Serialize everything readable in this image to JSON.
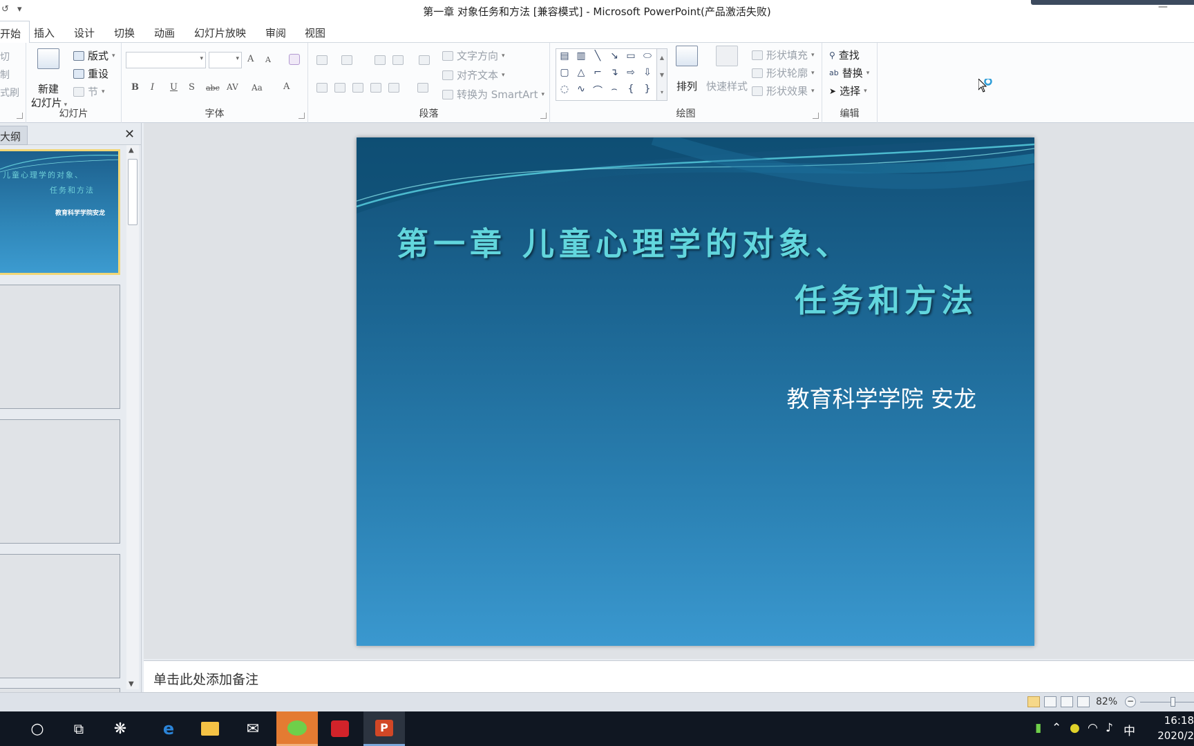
{
  "window": {
    "title": "第一章 对象任务和方法 [兼容模式] - Microsoft PowerPoint(产品激活失败)",
    "qat_undo": "↺",
    "qat_more": "▾",
    "minimize": "—"
  },
  "ribbon_tabs": [
    "开始",
    "插入",
    "设计",
    "切换",
    "动画",
    "幻灯片放映",
    "审阅",
    "视图"
  ],
  "clipboard": {
    "cut": "切",
    "copy": "制",
    "format_painter": "式刷"
  },
  "slides_group": {
    "label": "幻灯片",
    "new_slide_line1": "新建",
    "new_slide_line2": "幻灯片",
    "layout": "版式",
    "reset": "重设",
    "section": "节"
  },
  "font_group": {
    "label": "字体",
    "grow": "A",
    "shrink": "A",
    "bold": "B",
    "italic": "I",
    "underline": "U",
    "strike": "S",
    "abc": "abc",
    "spacing": "AV",
    "case": "Aa",
    "color": "A"
  },
  "paragraph_group": {
    "label": "段落",
    "text_direction": "文字方向",
    "align_text": "对齐文本",
    "convert_smartart": "转换为 SmartArt"
  },
  "drawing_group": {
    "label": "绘图",
    "arrange": "排列",
    "quick_styles": "快速样式",
    "shape_fill": "形状填充",
    "shape_outline": "形状轮廓",
    "shape_effects": "形状效果"
  },
  "editing_group": {
    "label": "编辑",
    "find": "查找",
    "replace": "替换",
    "select": "选择"
  },
  "left_panel": {
    "outline_tab": "大纲",
    "close": "✕",
    "thumb1_line1": "儿童心理学的对象、",
    "thumb1_line2": "任务和方法",
    "thumb1_sub": "教育科学学院安龙"
  },
  "slide": {
    "title_line1": "第一章 儿童心理学的对象、",
    "title_line2": "任务和方法",
    "subtitle": "教育科学学院 安龙"
  },
  "notes": {
    "placeholder": "单击此处添加备注"
  },
  "status": {
    "zoom": "82%"
  },
  "taskbar": {
    "apps": [
      "search-icon",
      "task-view-icon",
      "app-icon",
      "edge-icon",
      "file-explorer-icon",
      "mail-icon",
      "wechat-icon",
      "app-red-icon",
      "powerpoint-icon"
    ],
    "ime": "中",
    "time": "16:18",
    "date": "2020/2"
  }
}
